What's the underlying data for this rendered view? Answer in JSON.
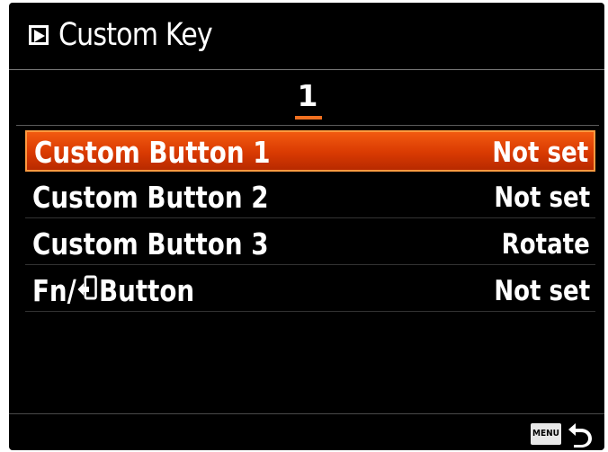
{
  "header": {
    "title": "Custom Key",
    "icon": "playback-icon"
  },
  "page": {
    "number": "1"
  },
  "rows": [
    {
      "label": "Custom Button 1",
      "value": "Not set",
      "selected": true
    },
    {
      "label": "Custom Button 2",
      "value": "Not set",
      "selected": false
    },
    {
      "label": "Custom Button 3",
      "value": "Rotate",
      "selected": false
    },
    {
      "label_prefix": "Fn/",
      "label_icon": "send-to-smartphone-icon",
      "label": "Button",
      "value": "Not set",
      "selected": false
    }
  ],
  "footer": {
    "menu_label": "MENU",
    "back_icon": "return-arrow-icon"
  },
  "colors": {
    "background": "#000000",
    "selection": "#e04808",
    "accent_underline": "#f07020",
    "text": "#ffffff"
  }
}
